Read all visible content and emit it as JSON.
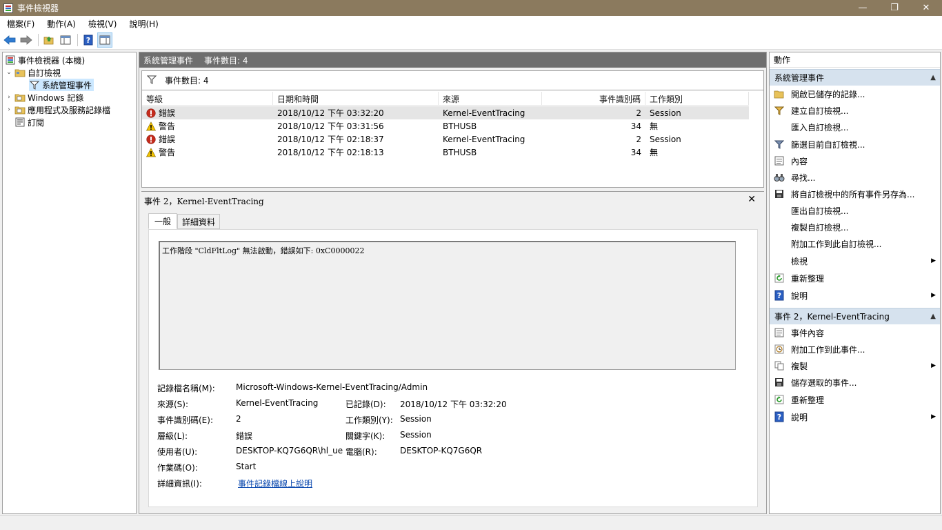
{
  "window": {
    "title": "事件檢視器",
    "minimize": "—",
    "maximize": "❐",
    "close": "✕"
  },
  "menubar": {
    "items": [
      "檔案(F)",
      "動作(A)",
      "檢視(V)",
      "說明(H)"
    ]
  },
  "toolbar": {
    "icons": [
      "back-arrow-icon",
      "forward-arrow-icon",
      "open-folder-icon",
      "show-hide-console-tree-icon",
      "help-icon",
      "show-action-pane-icon"
    ]
  },
  "tree": {
    "root": "事件檢視器 (本機)",
    "custom_views": "自訂檢視",
    "admin_events": "系統管理事件",
    "windows_logs": "Windows 記錄",
    "app_service_logs": "應用程式及服務記錄檔",
    "subscriptions": "訂閱"
  },
  "middle": {
    "header_title": "系統管理事件",
    "header_count": "事件數目: 4",
    "filter_label": "事件數目: 4",
    "columns": {
      "level": "等級",
      "datetime": "日期和時間",
      "source": "來源",
      "event_id": "事件識別碼",
      "task": "工作類別"
    },
    "rows": [
      {
        "level": "錯誤",
        "type": "error",
        "datetime": "2018/10/12 下午 03:32:20",
        "source": "Kernel-EventTracing",
        "event_id": "2",
        "task": "Session"
      },
      {
        "level": "警告",
        "type": "warning",
        "datetime": "2018/10/12 下午 03:31:56",
        "source": "BTHUSB",
        "event_id": "34",
        "task": "無"
      },
      {
        "level": "錯誤",
        "type": "error",
        "datetime": "2018/10/12 下午 02:18:37",
        "source": "Kernel-EventTracing",
        "event_id": "2",
        "task": "Session"
      },
      {
        "level": "警告",
        "type": "warning",
        "datetime": "2018/10/12 下午 02:18:13",
        "source": "BTHUSB",
        "event_id": "34",
        "task": "無"
      }
    ]
  },
  "detail": {
    "title": "事件 2，Kernel-EventTracing",
    "close": "✕",
    "tabs": {
      "general": "一般",
      "details": "詳細資料"
    },
    "message": "工作階段 \"CldFltLog\" 無法啟動，錯誤如下: 0xC0000022",
    "labels": {
      "log_name": "記錄檔名稱(M):",
      "source": "來源(S):",
      "event_id": "事件識別碼(E):",
      "level": "層級(L):",
      "user": "使用者(U):",
      "opcode": "作業碼(O):",
      "more_info": "詳細資訊(I):",
      "logged": "已記錄(D):",
      "task": "工作類別(Y):",
      "keywords": "關鍵字(K):",
      "computer": "電腦(R):"
    },
    "values": {
      "log_name": "Microsoft-Windows-Kernel-EventTracing/Admin",
      "source": "Kernel-EventTracing",
      "event_id": "2",
      "level": "錯誤",
      "user": "DESKTOP-KQ7G6QR\\hl_ue",
      "opcode": "Start",
      "more_info": "事件記錄檔線上說明",
      "logged": "2018/10/12 下午 03:32:20",
      "task": "Session",
      "keywords": "Session",
      "computer": "DESKTOP-KQ7G6QR"
    }
  },
  "actions": {
    "title": "動作",
    "section1": "系統管理事件",
    "section1_items": [
      "開啟已儲存的記錄...",
      "建立自訂檢視...",
      "匯入自訂檢視...",
      "篩選目前自訂檢視...",
      "內容",
      "尋找...",
      "將自訂檢視中的所有事件另存為...",
      "匯出自訂檢視...",
      "複製自訂檢視...",
      "附加工作到此自訂檢視...",
      "檢視",
      "重新整理",
      "說明"
    ],
    "section2": "事件 2，Kernel-EventTracing",
    "section2_items": [
      "事件內容",
      "附加工作到此事件...",
      "複製",
      "儲存選取的事件...",
      "重新整理",
      "說明"
    ]
  },
  "colors": {
    "titlebar": "#8b7a5e",
    "header": "#6e6e6e",
    "section": "#d6e2ee",
    "selected": "#cce8ff",
    "link": "#0645ad",
    "error": "#c42b1c",
    "warning": "#f2c200"
  }
}
